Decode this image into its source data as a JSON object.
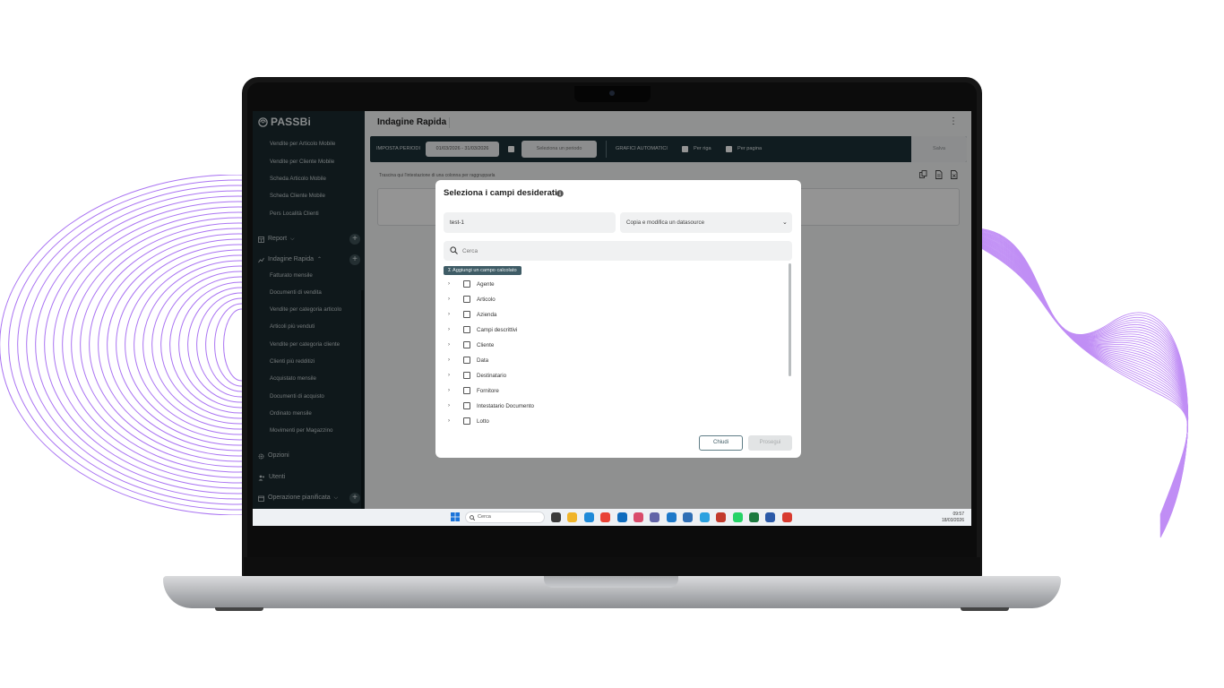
{
  "app": {
    "logo": "PASSBi",
    "page_title": "Indagine Rapida"
  },
  "sidebar": {
    "top_items": [
      "Vendite per Articolo Mobile",
      "Vendite per Cliente Mobile",
      "Scheda Articolo Mobile",
      "Scheda Cliente Mobile",
      "Pers Località Clienti"
    ],
    "report_label": "Report",
    "indagine_label": "Indagine Rapida",
    "indagine_items": [
      "Fatturato mensile",
      "Documenti di vendita",
      "Vendite per categoria articolo",
      "Articoli più venduti",
      "Vendite per categoria cliente",
      "Clienti più redditizi",
      "Acquistato mensile",
      "Documenti di acquisto",
      "Ordinato mensile",
      "Movimenti per Magazzino"
    ],
    "opzioni_label": "Opzioni",
    "utenti_label": "Utenti",
    "operazione_label": "Operazione pianificata"
  },
  "toolbar": {
    "imposta_periodi": "IMPOSTA PERIODI",
    "period_value": "01/03/2026 - 31/03/2026",
    "select_period": "Seleziona un periodo",
    "grafici_automatici": "GRAFICI AUTOMATICI",
    "per_riga": "Per riga",
    "per_pagina": "Per pagina",
    "save": "Salva"
  },
  "main": {
    "drag_hint": "Trascina qui l'intestazione di una colonna per raggrupparla"
  },
  "modal": {
    "title": "Seleziona i campi desiderati",
    "datasource_name": "test-1",
    "datasource_select": "Copia e modifica un datasource",
    "search_placeholder": "Cerca",
    "calc_button": "Aggiungi un campo calcolato",
    "fields": [
      "Agente",
      "Articolo",
      "Azienda",
      "Campi descrittivi",
      "Cliente",
      "Data",
      "Destinatario",
      "Fornitore",
      "Intestatario Documento",
      "Lotto"
    ],
    "close": "Chiudi",
    "next": "Prosegui"
  },
  "taskbar": {
    "search_placeholder": "Cerca",
    "time": "09:57",
    "date": "18/03/2026"
  },
  "colors": {
    "sidebar": "#1a2a2f",
    "toolbar": "#1d3138",
    "accent": "#3f5c66",
    "wave": "#9b5cf0"
  }
}
